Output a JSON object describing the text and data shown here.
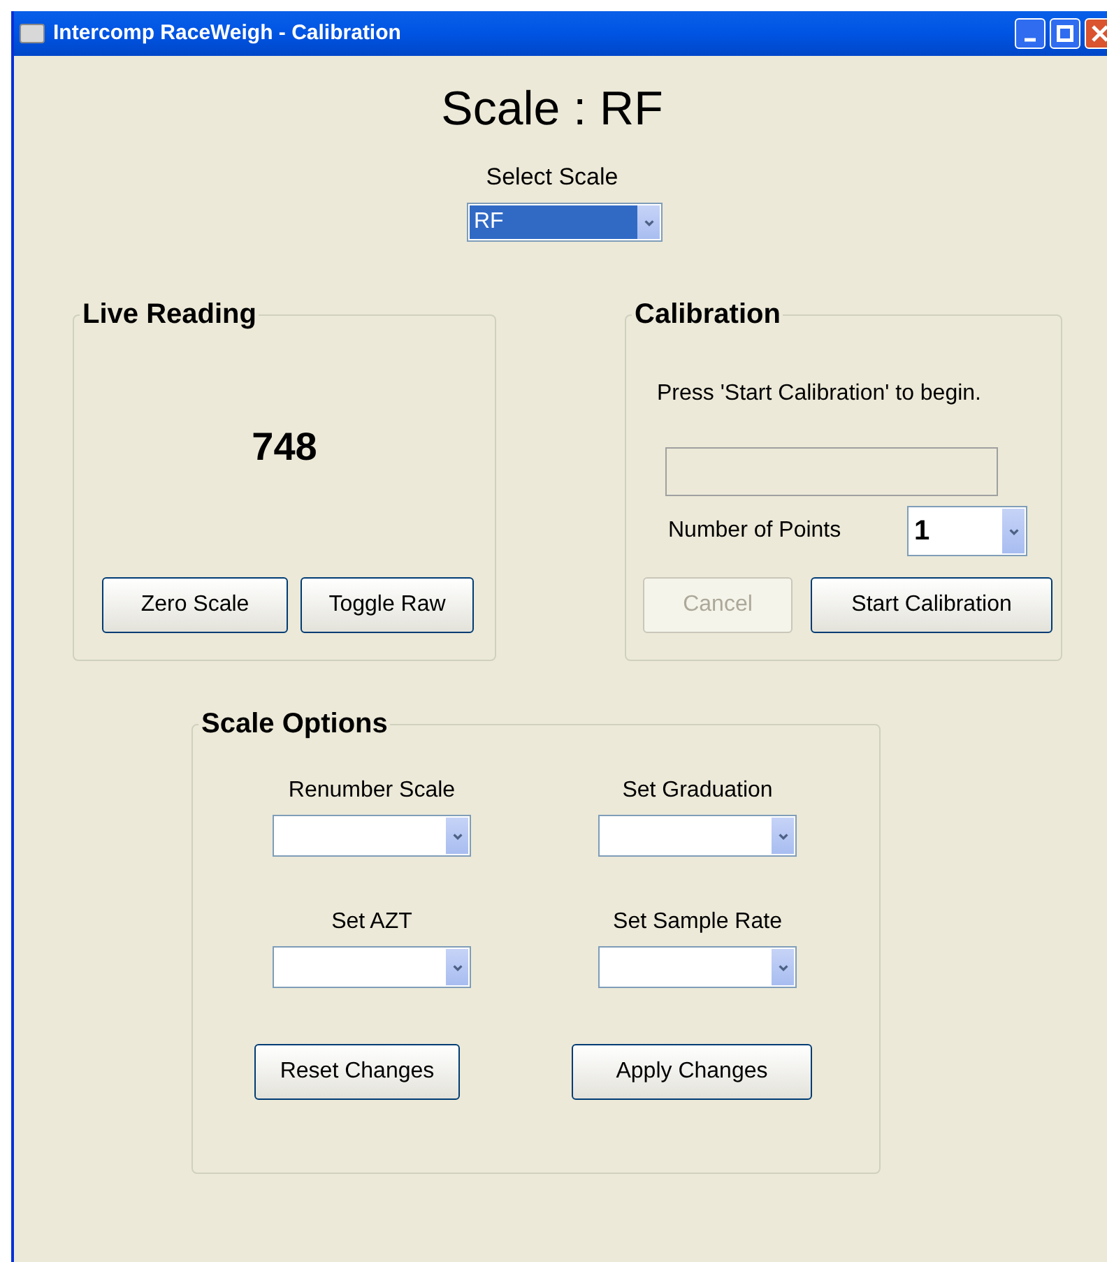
{
  "window": {
    "title": "Intercomp RaceWeigh - Calibration"
  },
  "heading": "Scale : RF",
  "scale_select": {
    "label": "Select Scale",
    "value": "RF",
    "focused": true
  },
  "live_reading": {
    "title": "Live Reading",
    "value": "748",
    "buttons": [
      {
        "label": "Zero Scale",
        "disabled": false
      },
      {
        "label": "Toggle Raw",
        "disabled": false
      }
    ]
  },
  "calibration": {
    "title": "Calibration",
    "message": "Press 'Start Calibration' to begin.",
    "points": {
      "label": "Number of Points",
      "value": "1"
    },
    "buttons": [
      {
        "label": "Cancel",
        "disabled": true
      },
      {
        "label": "Start Calibration",
        "disabled": false
      }
    ]
  },
  "scale_options": {
    "title": "Scale Options",
    "fields": [
      {
        "label": "Renumber Scale"
      },
      {
        "label": "Set Graduation"
      },
      {
        "label": "Set AZT"
      },
      {
        "label": "Set Sample Rate"
      }
    ],
    "buttons": [
      {
        "label": "Reset Changes",
        "disabled": false
      },
      {
        "label": "Apply Changes",
        "disabled": false
      }
    ]
  }
}
